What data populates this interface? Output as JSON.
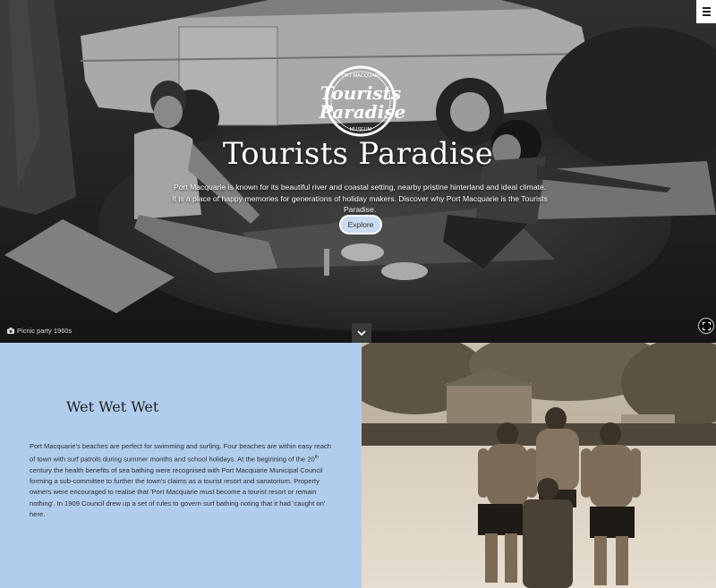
{
  "menu": {
    "icon": "hamburger-icon"
  },
  "hero": {
    "logo": {
      "arc_top": "PORT MACQUARIE",
      "line1": "Tourists",
      "line2": "Paradise",
      "arc_bottom": "MUSEUM"
    },
    "title": "Tourists Paradise",
    "description": "Port Macquarie is known for its beautiful river and coastal setting, nearby pristine hinterland and ideal climate. It is a place of happy memories for generations of holiday makers. Discover why Port Macquarie is the Tourists Paradise.",
    "explore_label": "Explore",
    "caption": "Picnic party 1960s",
    "caption_icon": "camera-icon",
    "scroll_icon": "chevron-down-icon",
    "fullscreen_icon": "expand-icon"
  },
  "section": {
    "heading": "Wet Wet Wet",
    "body_part1": "Port Macquarie's beaches are perfect for swimming and surfing. Four beaches are within easy reach of town with surf patrols during summer months and school holidays. At the beginning of the 20",
    "body_sup": "th",
    "body_part2": " century the health benefits of sea bathing were recognised with Port Macquarie Municipal Council forming a sub-committee to further the town's claims as a tourist resort and sanatorium. Property owners were encouraged to realise that 'Port Macquarie must become a tourist resort or remain nothing'. In 1909 Council drew up a set of rules to govern surf bathing noting that it had 'caught on' here."
  },
  "colors": {
    "section_bg": "#b1cdee",
    "explore_bg": "#c9dcf1"
  }
}
